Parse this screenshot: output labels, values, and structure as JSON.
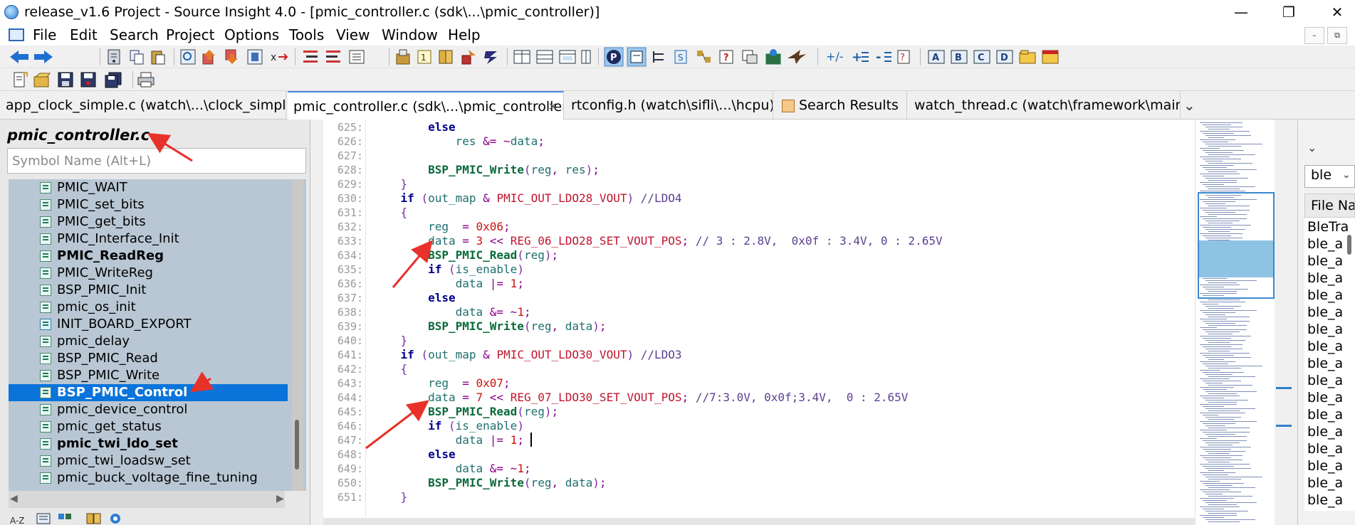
{
  "window": {
    "title": "release_v1.6 Project - Source Insight 4.0 - [pmic_controller.c (sdk\\...\\pmic_controller)]",
    "minimize": "—",
    "restore": "❐",
    "close": "✕"
  },
  "menu": {
    "items": [
      "File",
      "Edit",
      "Search",
      "Project",
      "Options",
      "Tools",
      "View",
      "Window",
      "Help"
    ],
    "mdi_minimize": "–",
    "mdi_restore": "⧉"
  },
  "tabs": [
    {
      "label": "app_clock_simple.c (watch\\...\\clock_simple)",
      "active": false
    },
    {
      "label": "pmic_controller.c (sdk\\...\\pmic_controller)",
      "active": true,
      "close": "✕"
    },
    {
      "label": "rtconfig.h (watch\\sifli\\...\\hcpu)",
      "active": false
    },
    {
      "label": "Search Results",
      "active": false
    },
    {
      "label": "watch_thread.c (watch\\framework\\main)",
      "active": false
    }
  ],
  "tab_overflow": "⌄",
  "symbol_pane": {
    "file_title": "pmic_controller.c",
    "search_placeholder": "Symbol Name (Alt+L)",
    "symbols": [
      {
        "label": "PMIC_WAIT",
        "bold": false
      },
      {
        "label": "PMIC_set_bits",
        "bold": false
      },
      {
        "label": "PMIC_get_bits",
        "bold": false
      },
      {
        "label": "PMIC_Interface_Init",
        "bold": false
      },
      {
        "label": "PMIC_ReadReg",
        "bold": true
      },
      {
        "label": "PMIC_WriteReg",
        "bold": false
      },
      {
        "label": "BSP_PMIC_Init",
        "bold": false
      },
      {
        "label": "pmic_os_init",
        "bold": false
      },
      {
        "label": "INIT_BOARD_EXPORT",
        "bold": false,
        "folder": true
      },
      {
        "label": "pmic_delay",
        "bold": false
      },
      {
        "label": "BSP_PMIC_Read",
        "bold": false
      },
      {
        "label": "BSP_PMIC_Write",
        "bold": false
      },
      {
        "label": "BSP_PMIC_Control",
        "bold": true,
        "selected": true
      },
      {
        "label": "pmic_device_control",
        "bold": false
      },
      {
        "label": "pmic_get_status",
        "bold": false
      },
      {
        "label": "pmic_twi_ldo_set",
        "bold": true
      },
      {
        "label": "pmic_twi_loadsw_set",
        "bold": false
      },
      {
        "label": "pmic_buck_voltage_fine_tuning",
        "bold": false
      }
    ],
    "scroll_left": "◀",
    "scroll_right": "▶"
  },
  "editor": {
    "line_numbers": [
      "625:",
      "626:",
      "627:",
      "628:",
      "629:",
      "630:",
      "631:",
      "632:",
      "633:",
      "634:",
      "635:",
      "636:",
      "637:",
      "638:",
      "639:",
      "640:",
      "641:",
      "642:",
      "643:",
      "644:",
      "645:",
      "646:",
      "647:",
      "648:",
      "649:",
      "650:",
      "651:"
    ],
    "lines": [
      "        else",
      "            res &= ~data;",
      "",
      "        BSP_PMIC_Write(reg, res);",
      "    }",
      "    if (out_map & PMIC_OUT_LDO28_VOUT) //LDO4",
      "    {",
      "        reg  = 0x06;",
      "        data = 3 << REG_06_LDO28_SET_VOUT_POS; // 3 : 2.8V,  0x0f : 3.4V, 0 : 2.65V",
      "        BSP_PMIC_Read(reg);",
      "        if (is_enable)",
      "            data |= 1;",
      "        else",
      "            data &= ~1;",
      "        BSP_PMIC_Write(reg, data);",
      "    }",
      "    if (out_map & PMIC_OUT_LDO30_VOUT) //LDO3",
      "    {",
      "        reg  = 0x07;",
      "        data = 7 << REG_07_LDO30_SET_VOUT_POS; //7:3.0V, 0x0f;3.4V,  0 : 2.65V",
      "        BSP_PMIC_Read(reg);",
      "        if (is_enable)",
      "            data |= 1;",
      "        else",
      "            data &= ~1;",
      "        BSP_PMIC_Write(reg, data);",
      "    }"
    ]
  },
  "right_pane": {
    "chevron": "⌄",
    "selected": "ble",
    "arrow": "⌄",
    "header": "File Name",
    "items": [
      "BleTra",
      "ble_a",
      "ble_a",
      "ble_a",
      "ble_a",
      "ble_a",
      "ble_a",
      "ble_a",
      "ble_a",
      "ble_a",
      "ble_a",
      "ble_a",
      "ble_a",
      "ble_a",
      "ble_a",
      "ble_a",
      "ble_a"
    ]
  },
  "colors": {
    "accent": "#0a74da",
    "annotation": "#e8312a",
    "keyword": "#00008b",
    "function": "#0a6a3a",
    "macro": "#c0152e",
    "number": "#d01010",
    "comment": "#5a3f90"
  }
}
